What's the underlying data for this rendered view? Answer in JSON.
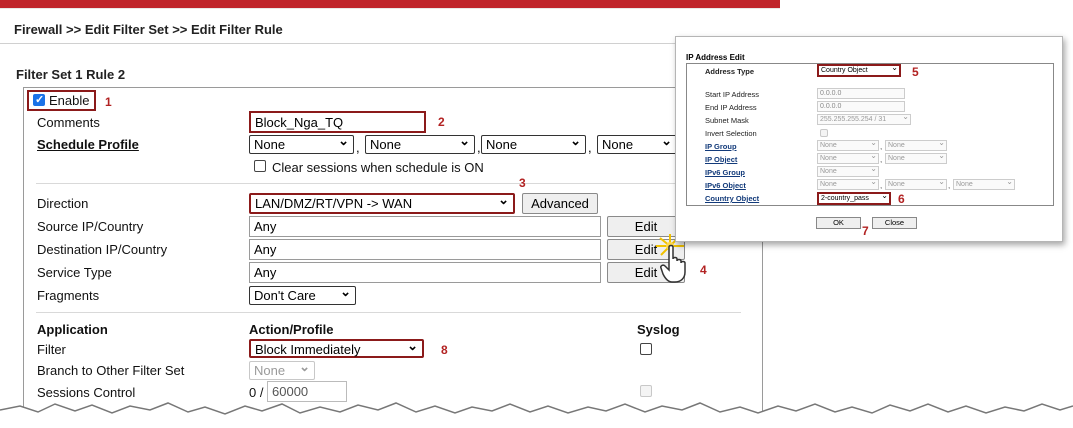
{
  "breadcrumb": "Firewall >> Edit Filter Set >> Edit Filter Rule",
  "section_title": "Filter Set 1 Rule 2",
  "enable": {
    "label": "Enable",
    "checked": true
  },
  "comments": {
    "label": "Comments",
    "value": "Block_Nga_TQ"
  },
  "schedule": {
    "label": "Schedule Profile",
    "options": [
      "None",
      "None",
      "None",
      "None"
    ],
    "clear_label": "Clear sessions when schedule is ON"
  },
  "direction": {
    "label": "Direction",
    "value": "LAN/DMZ/RT/VPN -> WAN",
    "advanced_label": "Advanced"
  },
  "source": {
    "label": "Source IP/Country",
    "value": "Any",
    "edit": "Edit"
  },
  "destination": {
    "label": "Destination IP/Country",
    "value": "Any",
    "edit": "Edit"
  },
  "service": {
    "label": "Service Type",
    "value": "Any",
    "edit": "Edit"
  },
  "fragments": {
    "label": "Fragments",
    "value": "Don't Care"
  },
  "app_header": {
    "application": "Application",
    "action": "Action/Profile",
    "syslog": "Syslog"
  },
  "filter": {
    "label": "Filter",
    "value": "Block Immediately"
  },
  "branch": {
    "label": "Branch to Other Filter Set",
    "value": "None"
  },
  "sessions": {
    "label": "Sessions Control",
    "prefix": "0 /",
    "value": "60000"
  },
  "annotations": [
    "1",
    "2",
    "3",
    "4",
    "5",
    "6",
    "7",
    "8"
  ],
  "popup": {
    "title": "IP Address Edit",
    "address_type": {
      "label": "Address Type",
      "value": "Country Object"
    },
    "start_ip": {
      "label": "Start IP Address",
      "value": "0.0.0.0"
    },
    "end_ip": {
      "label": "End IP Address",
      "value": "0.0.0.0"
    },
    "subnet": {
      "label": "Subnet Mask",
      "value": "255.255.255.254 / 31"
    },
    "invert": {
      "label": "Invert Selection"
    },
    "ip_group": {
      "label": "IP Group",
      "values": [
        "None",
        "None"
      ]
    },
    "ip_object": {
      "label": "IP Object",
      "values": [
        "None",
        "None"
      ]
    },
    "ipv6_group": {
      "label": "IPv6 Group",
      "values": [
        "None"
      ]
    },
    "ipv6_object": {
      "label": "IPv6 Object",
      "values": [
        "None",
        "None",
        "None"
      ]
    },
    "country_object": {
      "label": "Country Object",
      "value": "2-country_pass"
    },
    "ok": "OK",
    "close": "Close"
  },
  "colors": {
    "brand_bar": "#c0252b",
    "annotation": "#b22222",
    "checkbox": "#1a73e8"
  },
  "icons": [
    "hand-pointer-icon",
    "click-burst-icon"
  ]
}
